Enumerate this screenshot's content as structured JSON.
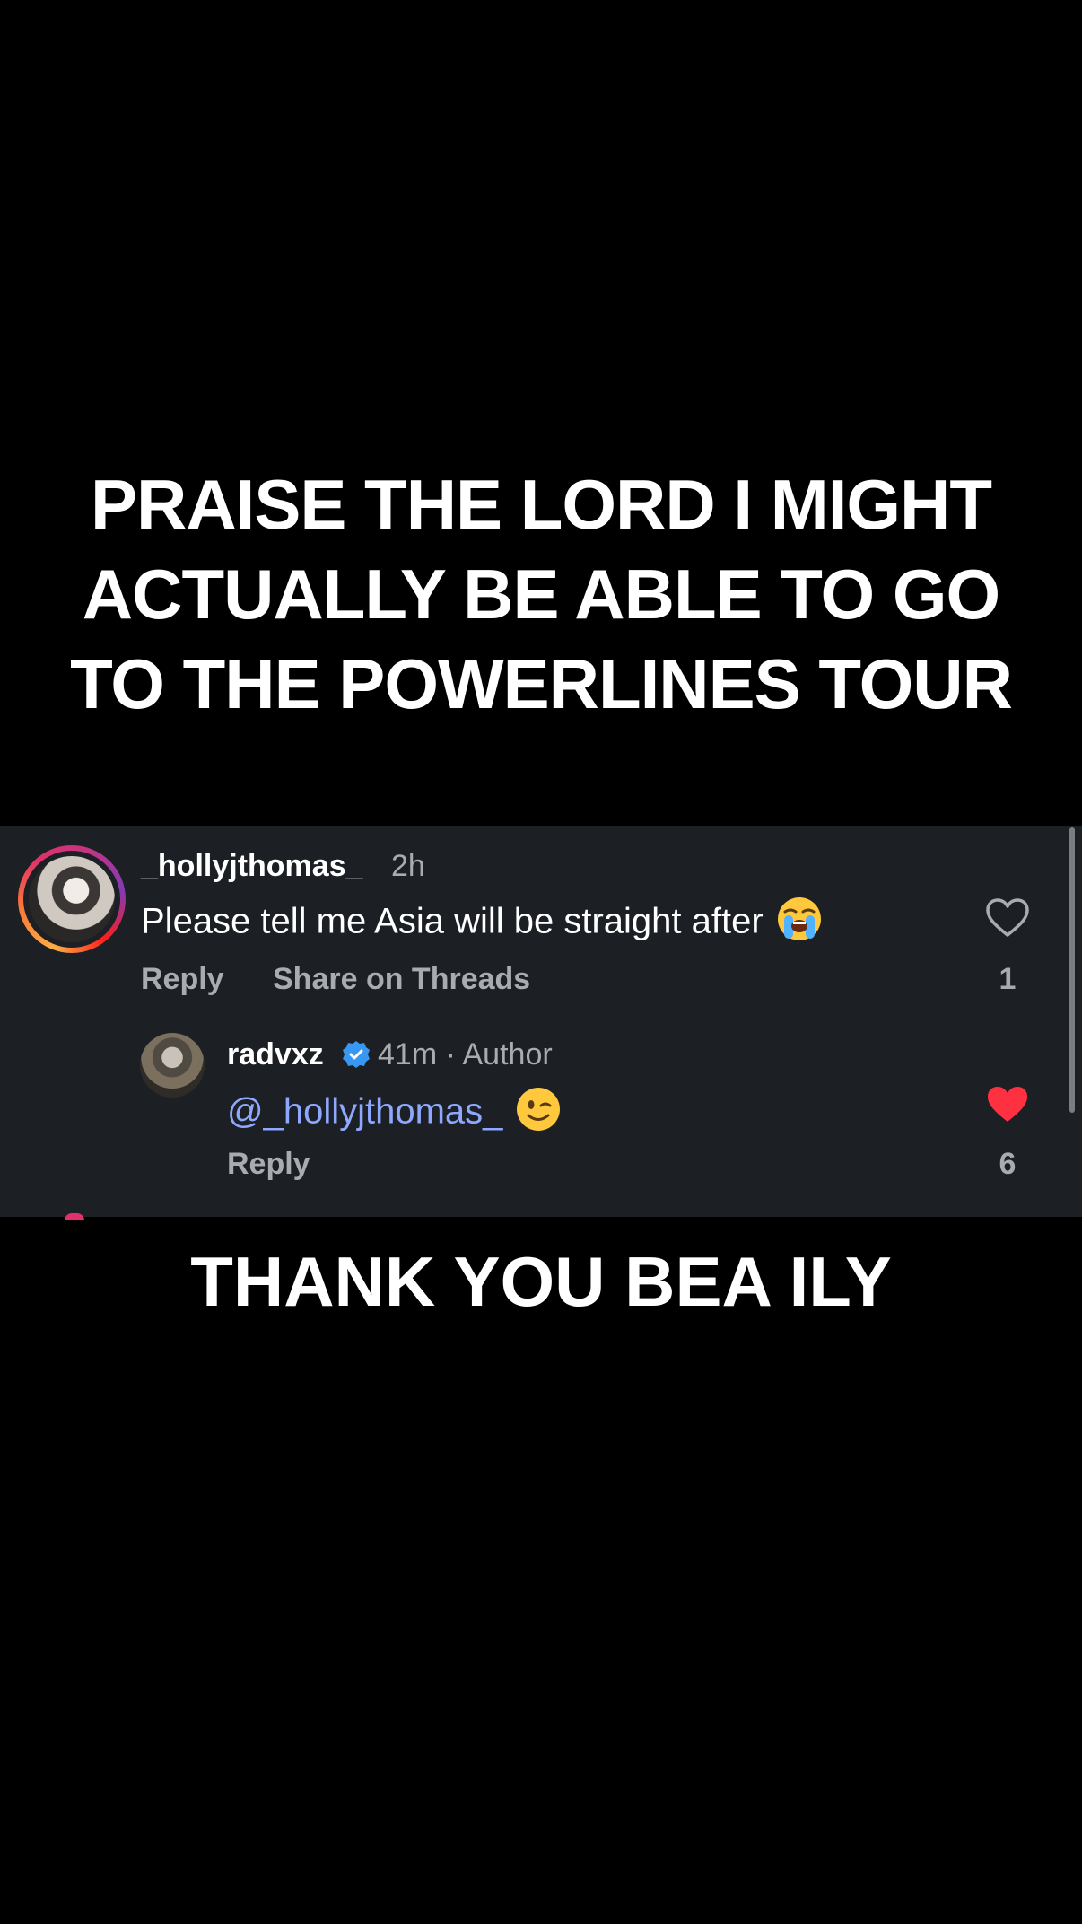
{
  "overlay": {
    "headline": "PRAISE THE LORD I MIGHT ACTUALLY BE ABLE TO GO TO THE POWERLINES TOUR",
    "caption": "THANK YOU BEA ILY"
  },
  "comment": {
    "username": "_hollyjthomas_",
    "time": "2h",
    "text": "Please tell me Asia will be straight after",
    "emoji": "loudly-crying-face",
    "reply_label": "Reply",
    "share_label": "Share on Threads",
    "like_count": "1",
    "liked": false
  },
  "reply": {
    "username": "radvxz",
    "verified": true,
    "time": "41m",
    "separator": "·",
    "role": "Author",
    "mention": "@_hollyjthomas_",
    "emoji": "winking-face",
    "reply_label": "Reply",
    "like_count": "6",
    "liked": true
  },
  "colors": {
    "panel_bg": "#1c1f24",
    "mention": "#8ea8ff",
    "like_red": "#ff3040",
    "verified_blue": "#3897f0",
    "muted_text": "#a8abb0"
  }
}
